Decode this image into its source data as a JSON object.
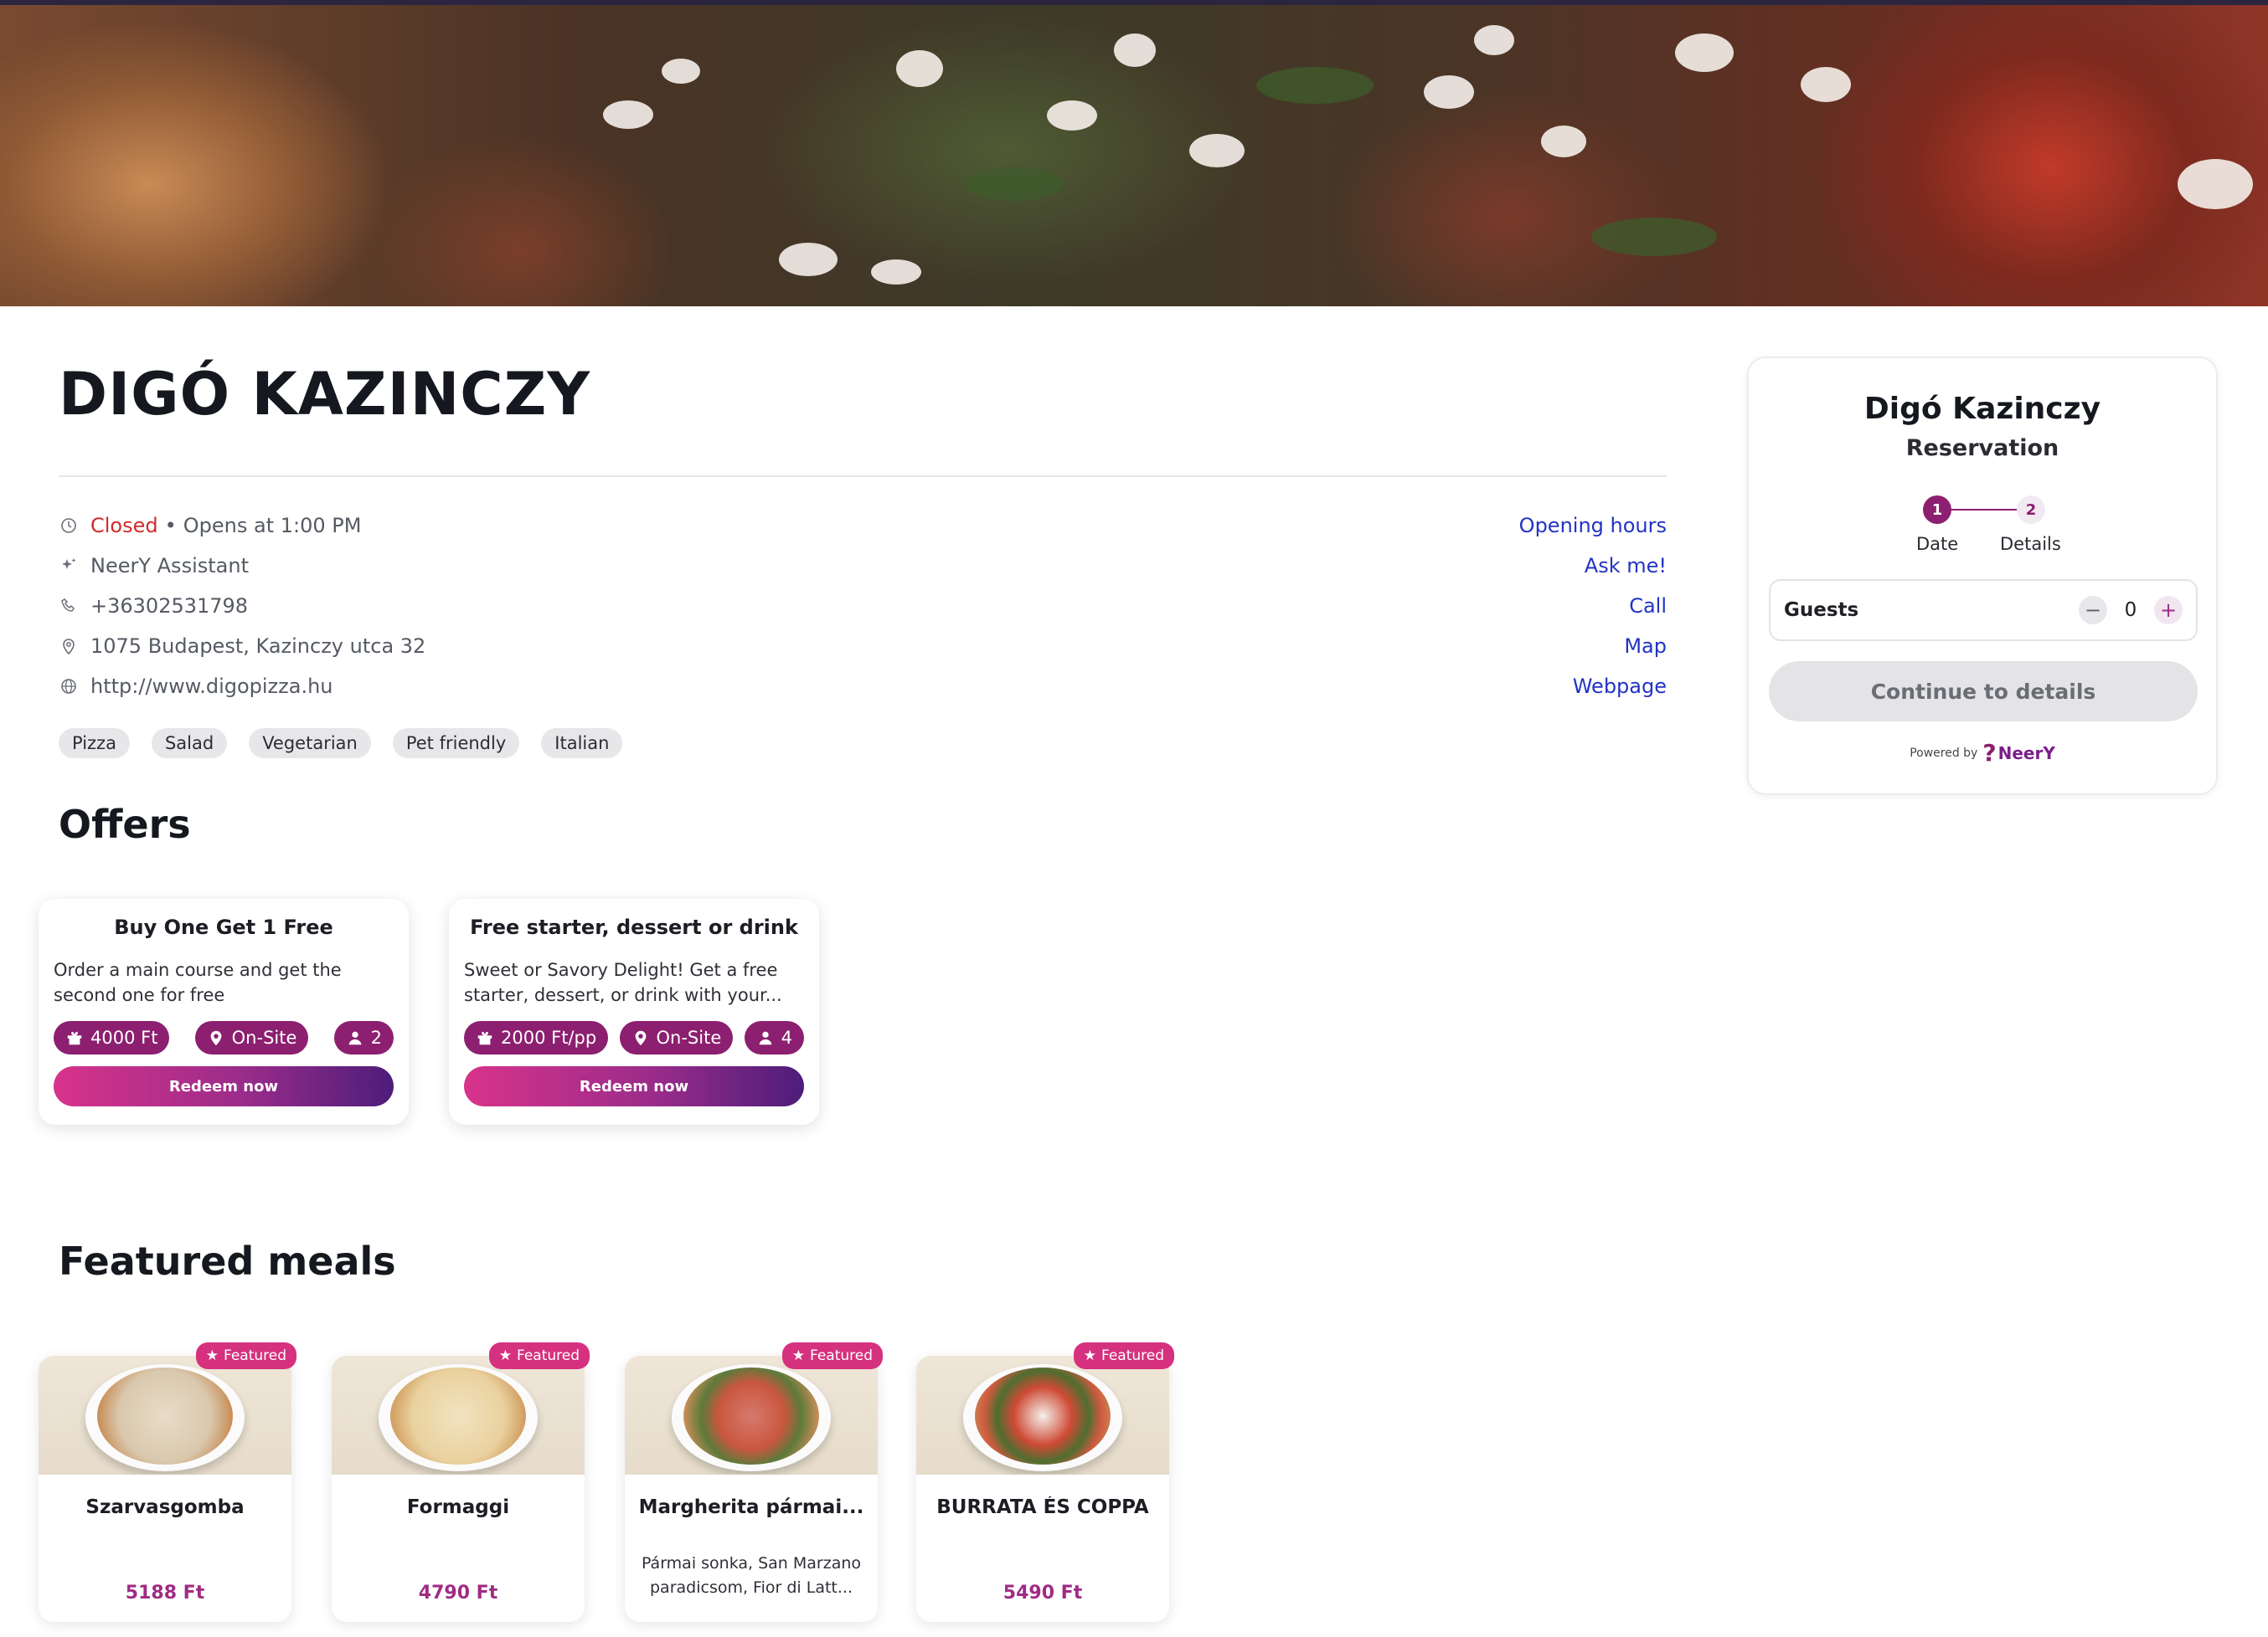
{
  "restaurant": {
    "name": "DIGÓ KAZINCZY"
  },
  "info": {
    "status": "Closed",
    "status_sep": "•",
    "opens": "Opens at 1:00 PM",
    "assistant": "NeerY Assistant",
    "phone": "+36302531798",
    "address": "1075 Budapest, Kazinczy utca 32",
    "website": "http://www.digopizza.hu",
    "links": {
      "opening_hours": "Opening hours",
      "ask": "Ask me!",
      "call": "Call",
      "map": "Map",
      "webpage": "Webpage"
    }
  },
  "tags": [
    "Pizza",
    "Salad",
    "Vegetarian",
    "Pet friendly",
    "Italian"
  ],
  "offers_title": "Offers",
  "offers": [
    {
      "title": "Buy One Get 1 Free",
      "description": "Order a main course and get the second one for free",
      "value": "4000 Ft",
      "location": "On-Site",
      "persons": "2",
      "cta": "Redeem now"
    },
    {
      "title": "Free starter, dessert or drink",
      "description": "Sweet or Savory Delight! Get a free starter, dessert, or drink with your...",
      "value": "2000 Ft/pp",
      "location": "On-Site",
      "persons": "4",
      "cta": "Redeem now"
    }
  ],
  "meals_title": "Featured meals",
  "meals": [
    {
      "badge": "Featured",
      "name": "Szarvasgomba",
      "description": "",
      "price": "5188 Ft"
    },
    {
      "badge": "Featured",
      "name": "Formaggi",
      "description": "",
      "price": "4790 Ft"
    },
    {
      "badge": "Featured",
      "name": "Margherita pármai...",
      "description": "Pármai sonka, San Marzano paradicsom, Fior di Latt...",
      "price": ""
    },
    {
      "badge": "Featured",
      "name": "BURRATA ÉS COPPA",
      "description": "",
      "price": "5490 Ft"
    }
  ],
  "reservation": {
    "title": "Digó Kazinczy",
    "subtitle": "Reservation",
    "steps": [
      {
        "number": "1",
        "label": "Date"
      },
      {
        "number": "2",
        "label": "Details"
      }
    ],
    "guests_label": "Guests",
    "guests_value": "0",
    "minus": "−",
    "plus": "+",
    "continue_label": "Continue to details",
    "powered_by": "Powered by",
    "brand": "NeerY"
  },
  "colors": {
    "accent": "#8c1f6f",
    "closed": "#d12b2b",
    "link": "#2233c4",
    "badge": "#d6317f"
  }
}
